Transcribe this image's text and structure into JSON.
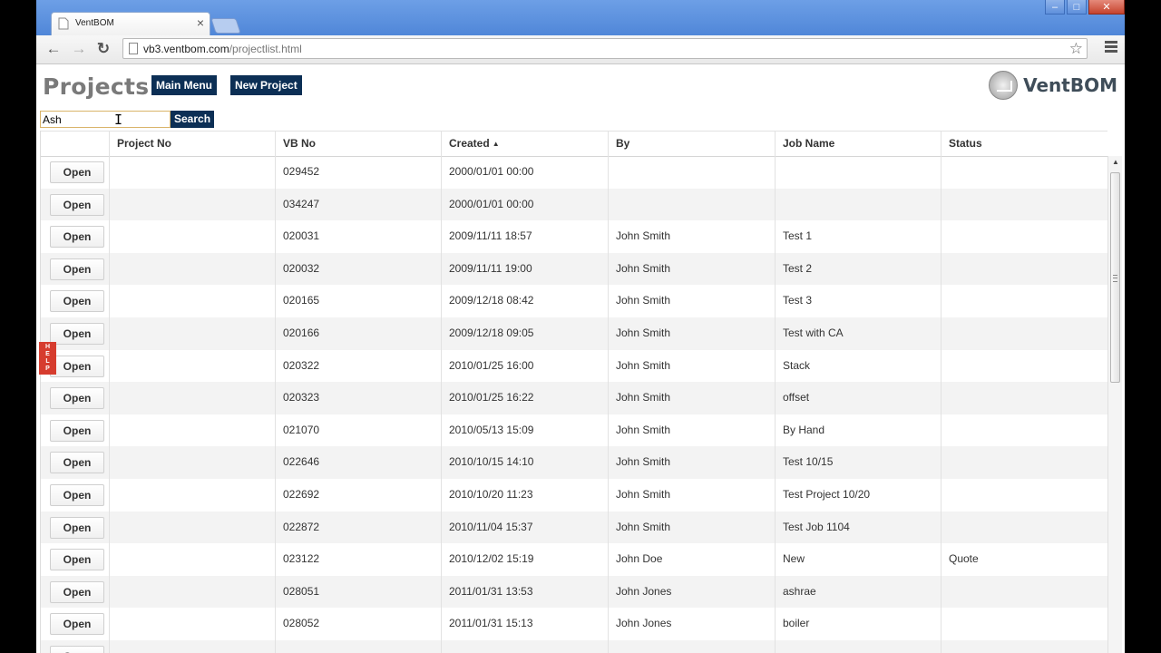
{
  "browser": {
    "tab_title": "VentBOM",
    "tab_close": "×",
    "url_host": "vb3.ventbom.com",
    "url_path": "/projectlist.html",
    "back_glyph": "←",
    "forward_glyph": "→",
    "reload_glyph": "↻",
    "star_glyph": "☆",
    "minimize_glyph": "–",
    "maximize_glyph": "□",
    "close_glyph": "✕"
  },
  "page": {
    "title": "Projects",
    "main_menu_label": "Main Menu",
    "new_project_label": "New Project",
    "logo_text": "VentBOM",
    "search_value": "Ash",
    "search_label": "Search",
    "help_label": "HELP"
  },
  "table": {
    "columns": [
      "",
      "Project No",
      "VB No",
      "Created",
      "By",
      "Job Name",
      "Status"
    ],
    "sorted_column": "Created",
    "sort_direction": "ascending",
    "sort_glyph": "▲",
    "open_label": "Open",
    "rows": [
      {
        "project_no": "",
        "vb_no": "029452",
        "created": "2000/01/01 00:00",
        "by": "",
        "job_name": "",
        "status": ""
      },
      {
        "project_no": "",
        "vb_no": "034247",
        "created": "2000/01/01 00:00",
        "by": "",
        "job_name": "",
        "status": ""
      },
      {
        "project_no": "",
        "vb_no": "020031",
        "created": "2009/11/11 18:57",
        "by": "John Smith",
        "job_name": "Test 1",
        "status": ""
      },
      {
        "project_no": "",
        "vb_no": "020032",
        "created": "2009/11/11 19:00",
        "by": "John Smith",
        "job_name": "Test 2",
        "status": ""
      },
      {
        "project_no": "",
        "vb_no": "020165",
        "created": "2009/12/18 08:42",
        "by": "John Smith",
        "job_name": "Test 3",
        "status": ""
      },
      {
        "project_no": "",
        "vb_no": "020166",
        "created": "2009/12/18 09:05",
        "by": "John Smith",
        "job_name": "Test with CA",
        "status": ""
      },
      {
        "project_no": "",
        "vb_no": "020322",
        "created": "2010/01/25 16:00",
        "by": "John Smith",
        "job_name": "Stack",
        "status": ""
      },
      {
        "project_no": "",
        "vb_no": "020323",
        "created": "2010/01/25 16:22",
        "by": "John Smith",
        "job_name": "offset",
        "status": ""
      },
      {
        "project_no": "",
        "vb_no": "021070",
        "created": "2010/05/13 15:09",
        "by": "John Smith",
        "job_name": "By Hand",
        "status": ""
      },
      {
        "project_no": "",
        "vb_no": "022646",
        "created": "2010/10/15 14:10",
        "by": "John Smith",
        "job_name": "Test 10/15",
        "status": ""
      },
      {
        "project_no": "",
        "vb_no": "022692",
        "created": "2010/10/20 11:23",
        "by": "John Smith",
        "job_name": "Test Project 10/20",
        "status": ""
      },
      {
        "project_no": "",
        "vb_no": "022872",
        "created": "2010/11/04 15:37",
        "by": "John Smith",
        "job_name": "Test Job 1104",
        "status": ""
      },
      {
        "project_no": "",
        "vb_no": "023122",
        "created": "2010/12/02 15:19",
        "by": "John Doe",
        "job_name": "New",
        "status": "Quote"
      },
      {
        "project_no": "",
        "vb_no": "028051",
        "created": "2011/01/31 13:53",
        "by": "John Jones",
        "job_name": "ashrae",
        "status": ""
      },
      {
        "project_no": "",
        "vb_no": "028052",
        "created": "2011/01/31 15:13",
        "by": "John Jones",
        "job_name": "boiler",
        "status": ""
      },
      {
        "project_no": "",
        "vb_no": "",
        "created": "",
        "by": "",
        "job_name": "",
        "status": ""
      }
    ]
  },
  "colors": {
    "button_navy": "#0c2f55",
    "title_gray": "#7a7a7a",
    "help_red": "#d63c2e",
    "titlebar_blue": "#4f86d8"
  }
}
